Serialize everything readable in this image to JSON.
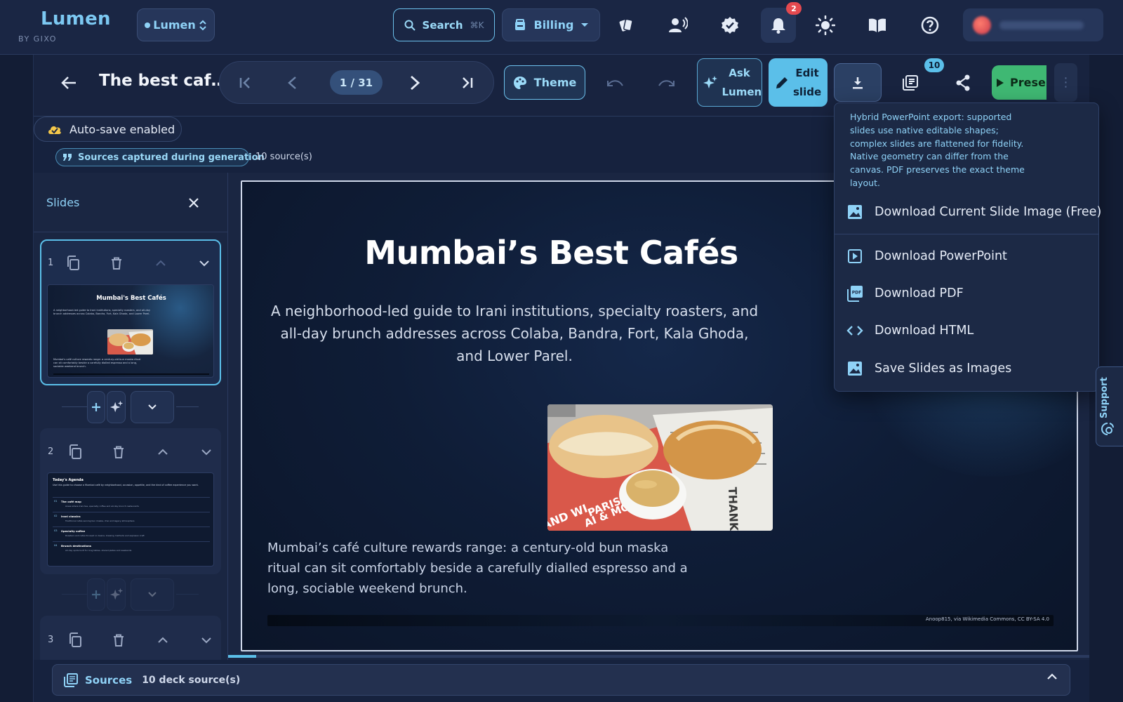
{
  "app": {
    "logo": "Lumen",
    "logo_sub": "BY GIXO",
    "workspace_label": "Lumen"
  },
  "header": {
    "search_label": "Search",
    "search_shortcut": "⌘K",
    "billing_label": "Billing",
    "notifications_count": "2"
  },
  "toolbar": {
    "deck_title": "The best caf…",
    "page_indicator": "1 / 31",
    "theme_label": "Theme",
    "ask_label": "Ask Lumen",
    "edit_label": "Edit slide",
    "deck_badge": "10",
    "present_label": "Present"
  },
  "status": {
    "autosave": "Auto-save enabled",
    "sources_chip": "Sources captured during generation",
    "sources_count": "10 source(s)"
  },
  "sidebar": {
    "title": "Slides",
    "slides": [
      {
        "number": "1",
        "thumb_title": "Mumbai's Best Cafés",
        "thumb_sub": "A neighborhood-led guide to Irani institutions, specialty roasters, and all-day brunch addresses across Colaba, Bandra, Fort, Kala Ghoda, and Lower Parel.",
        "thumb_body": "Mumbai's café culture rewards range: a century-old bun maska ritual can sit comfortably beside a carefully dialled espresso and a long, sociable weekend brunch."
      },
      {
        "number": "2",
        "thumb_title": "Today's Agenda",
        "thumb_sub": "Use this guide to choose a Mumbai café by neighborhood, occasion, appetite, and the kind of coffee experience you want.",
        "agenda": [
          {
            "n": "01",
            "title": "The café map",
            "desc": "Areas where Irani tea, specialty coffee and all-day brunch restaurants"
          },
          {
            "n": "02",
            "title": "Irani classics",
            "desc": "Traditional cafés serving bun maska, chai and legacy atmosphere"
          },
          {
            "n": "03",
            "title": "Specialty coffee",
            "desc": "Roasters and cafés focused on beans, brewing methods and espresso craft"
          },
          {
            "n": "04",
            "title": "Brunch destinations",
            "desc": "All-day spots built for long tables, shared plates and weekends"
          }
        ]
      },
      {
        "number": "3"
      }
    ]
  },
  "slide": {
    "title": "Mumbai’s Best Cafés",
    "subtitle": "A neighborhood-led guide to Irani institutions, specialty roasters, and all-day brunch addresses across Colaba, Bandra, Fort, Kala Ghoda, and Lower Parel.",
    "body": "Mumbai’s café culture rewards range: a century-old bun maska ritual can sit comfortably beside a carefully dialled espresso and a long, sociable weekend brunch.",
    "credit": "Anoop815, via Wikimedia Commons, CC BY-SA 4.0",
    "photo_text": {
      "a": "THANK U",
      "b": "PARIS,",
      "c": "AI & MORE.",
      "d": "AND WI",
      "e": "AN"
    }
  },
  "download_menu": {
    "note": "Hybrid PowerPoint export: supported slides use native editable shapes; complex slides are flattened for fidelity. Native geometry can differ from the canvas. PDF preserves the exact theme layout.",
    "items": [
      {
        "label": "Download Current Slide Image (Free)",
        "icon": "image-icon"
      },
      {
        "label": "Download PowerPoint",
        "icon": "slideshow-icon"
      },
      {
        "label": "Download PDF",
        "icon": "pdf-icon"
      },
      {
        "label": "Download HTML",
        "icon": "code-icon"
      },
      {
        "label": "Save Slides as Images",
        "icon": "image-icon"
      }
    ]
  },
  "support": {
    "label": "Support"
  },
  "sources_bar": {
    "title": "Sources",
    "count": "10 deck source(s)"
  },
  "colors": {
    "accent": "#5bbfe9",
    "present": "#3fb873",
    "badge": "#e4494f",
    "background": "#16223e"
  }
}
